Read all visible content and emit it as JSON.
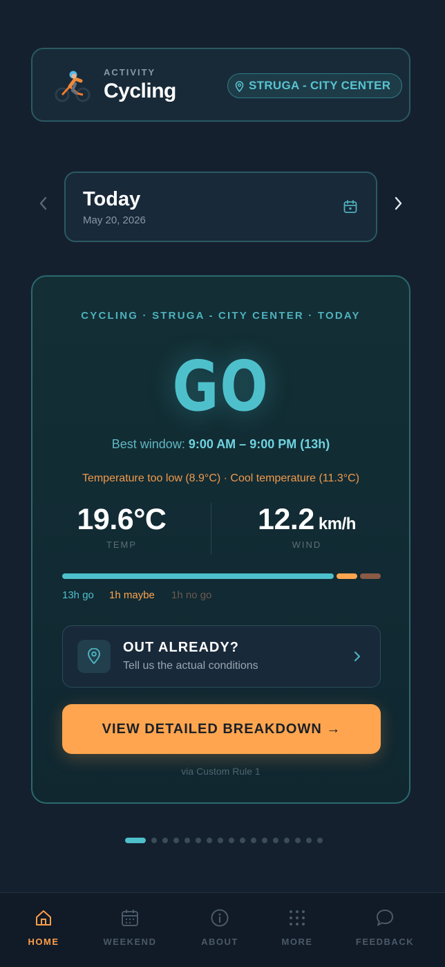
{
  "activity": {
    "label": "ACTIVITY",
    "name": "Cycling",
    "icon": "cyclist-icon",
    "location": "STRUGA - CITY CENTER"
  },
  "date": {
    "title": "Today",
    "subtitle": "May 20, 2026"
  },
  "forecast": {
    "context": "CYCLING · STRUGA - CITY CENTER · TODAY",
    "verdict": "GO",
    "window_prefix": "Best window: ",
    "window_value": "9:00 AM – 9:00 PM (13h)",
    "warnings": "Temperature too low (8.9°C) · Cool temperature (11.3°C)",
    "temp_value": "19.6°C",
    "temp_label": "TEMP",
    "wind_value": "12.2",
    "wind_unit": " km/h",
    "wind_label": "WIND",
    "hours_go": 13,
    "hours_maybe": 1,
    "hours_nogo": 1,
    "legend_go": "13h go",
    "legend_maybe": "1h maybe",
    "legend_nogo": "1h no go",
    "out_title": "OUT ALREADY?",
    "out_subtitle": "Tell us the actual conditions",
    "cta_label": "VIEW DETAILED BREAKDOWN →",
    "via": "via Custom Rule 1"
  },
  "pager": {
    "count": 17,
    "active_index": 0
  },
  "nav": [
    {
      "label": "HOME",
      "icon": "home-icon",
      "active": true
    },
    {
      "label": "WEEKEND",
      "icon": "calendar-icon",
      "active": false
    },
    {
      "label": "ABOUT",
      "icon": "info-icon",
      "active": false
    },
    {
      "label": "MORE",
      "icon": "grid-icon",
      "active": false
    },
    {
      "label": "FEEDBACK",
      "icon": "chat-bubble-icon",
      "active": false
    }
  ],
  "colors": {
    "accent_teal": "#4ec0cc",
    "accent_orange": "#ffa54f",
    "nogo_brown": "#8a5a45",
    "background": "#15202f"
  }
}
